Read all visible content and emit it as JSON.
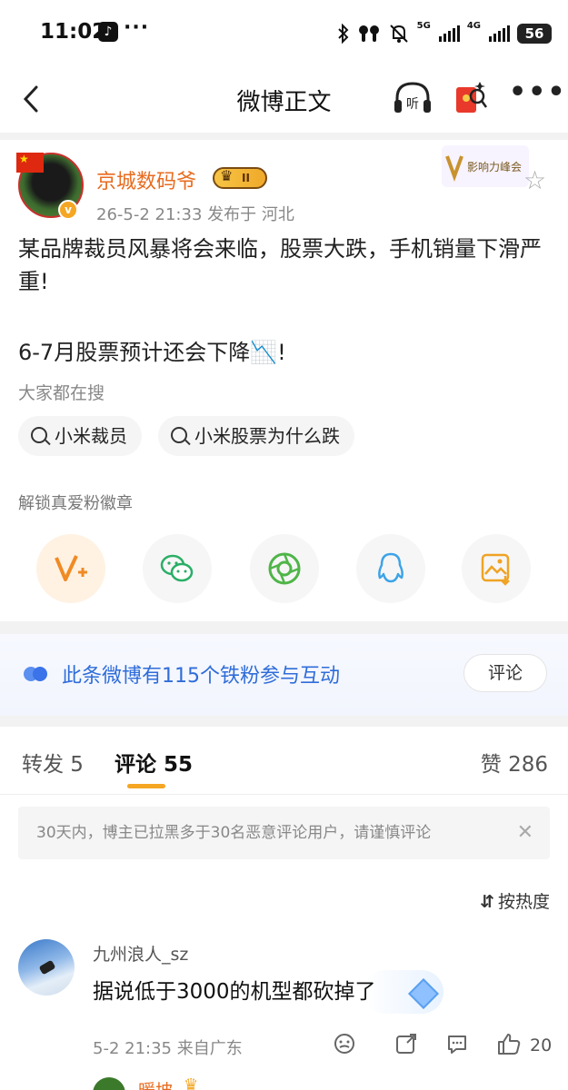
{
  "status_bar": {
    "time": "11:02",
    "net1": "5G",
    "net2": "4G",
    "battery": "56"
  },
  "nav": {
    "title": "微博正文",
    "listen_label": "听"
  },
  "post": {
    "username": "京城数码爷",
    "rank_badge": "II",
    "meta": "26-5-2 21:33  发布于 河北",
    "influence_badge": "影响力峰会",
    "line1": "某品牌裁员风暴将会来临，股票大跌，手机销量下滑严",
    "line2": "重!",
    "line3": "6-7月股票预计还会下降📉!"
  },
  "search": {
    "label": "大家都在搜",
    "chips": [
      "小米裁员",
      "小米股票为什么跌"
    ]
  },
  "share": {
    "label": "解锁真爱粉徽章",
    "icons": [
      "v-plus-icon",
      "wechat-icon",
      "moments-icon",
      "qq-icon",
      "save-image-icon"
    ]
  },
  "fans": {
    "text": "此条微博有115个铁粉参与互动",
    "comment_button": "评论"
  },
  "tabs": {
    "repost": "转发 5",
    "comment": "评论 55",
    "like": "赞 286"
  },
  "notice": {
    "text": "30天内，博主已拉黑多于30名恶意评论用户，请谨慎评论"
  },
  "sort": {
    "label": "按热度"
  },
  "comments": [
    {
      "user": "九州浪人_sz",
      "text": "据说低于3000的机型都砍掉了",
      "meta": "5-2 21:35  来自广东",
      "likes": "20"
    }
  ],
  "next_comment": {
    "user": "暖坡"
  },
  "colors": {
    "accent_orange": "#e86b1e",
    "link_blue": "#2f6dd9",
    "tab_underline": "#f5a623"
  }
}
